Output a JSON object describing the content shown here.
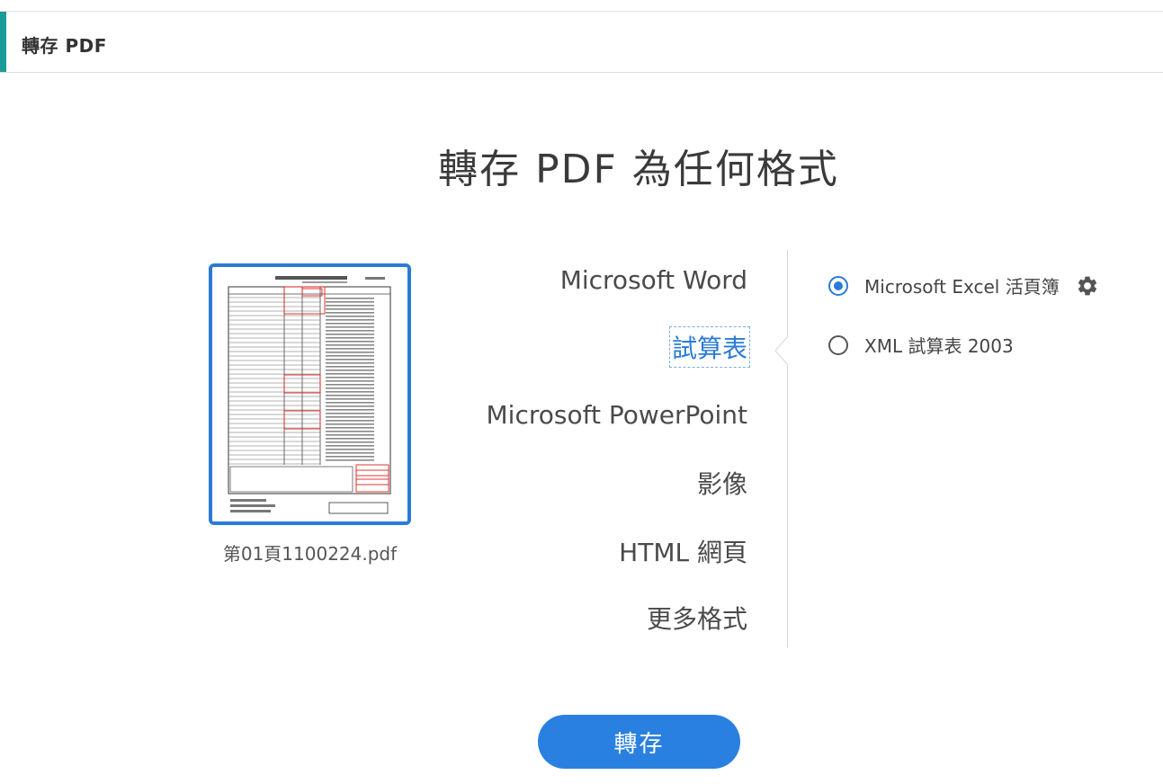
{
  "header": {
    "title": "轉存 PDF"
  },
  "main": {
    "heading": "轉存 PDF 為任何格式"
  },
  "file": {
    "name": "第01頁1100224.pdf"
  },
  "formats": [
    {
      "label": "Microsoft Word"
    },
    {
      "label": "試算表"
    },
    {
      "label": "Microsoft PowerPoint"
    },
    {
      "label": "影像"
    },
    {
      "label": "HTML 網頁"
    },
    {
      "label": "更多格式"
    }
  ],
  "selected_format": "試算表",
  "options": [
    {
      "label": "Microsoft Excel 活頁簿",
      "checked": true
    },
    {
      "label": "XML 試算表 2003",
      "checked": false
    }
  ],
  "icons": {
    "settings": "gear-icon"
  },
  "actions": {
    "convert_label": "轉存"
  },
  "colors": {
    "accent_blue": "#2a7bd6",
    "button_blue": "#2a80e0",
    "teal_marker": "#1b9a9a"
  }
}
